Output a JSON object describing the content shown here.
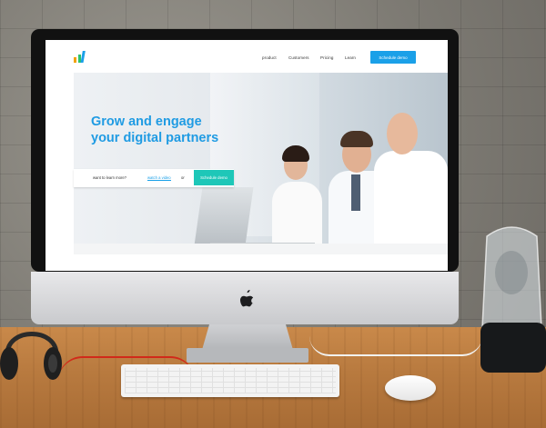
{
  "website": {
    "nav": {
      "links": [
        "product",
        "Customers",
        "Pricing",
        "Learn"
      ],
      "cta_label": "Schedule demo"
    },
    "hero": {
      "title_line1": "Grow and engage",
      "title_line2": "your digital partners",
      "prompt_text": "want to learn more?",
      "watch_video_link": "watch a video",
      "or_text": "or",
      "cta_label": "Schedule demo"
    },
    "colors": {
      "accent_blue": "#1aa0e8",
      "accent_teal": "#1ec7b8"
    }
  },
  "icons": {
    "logo": "bar-chart-logo-icon",
    "apple": "apple-logo-icon"
  }
}
